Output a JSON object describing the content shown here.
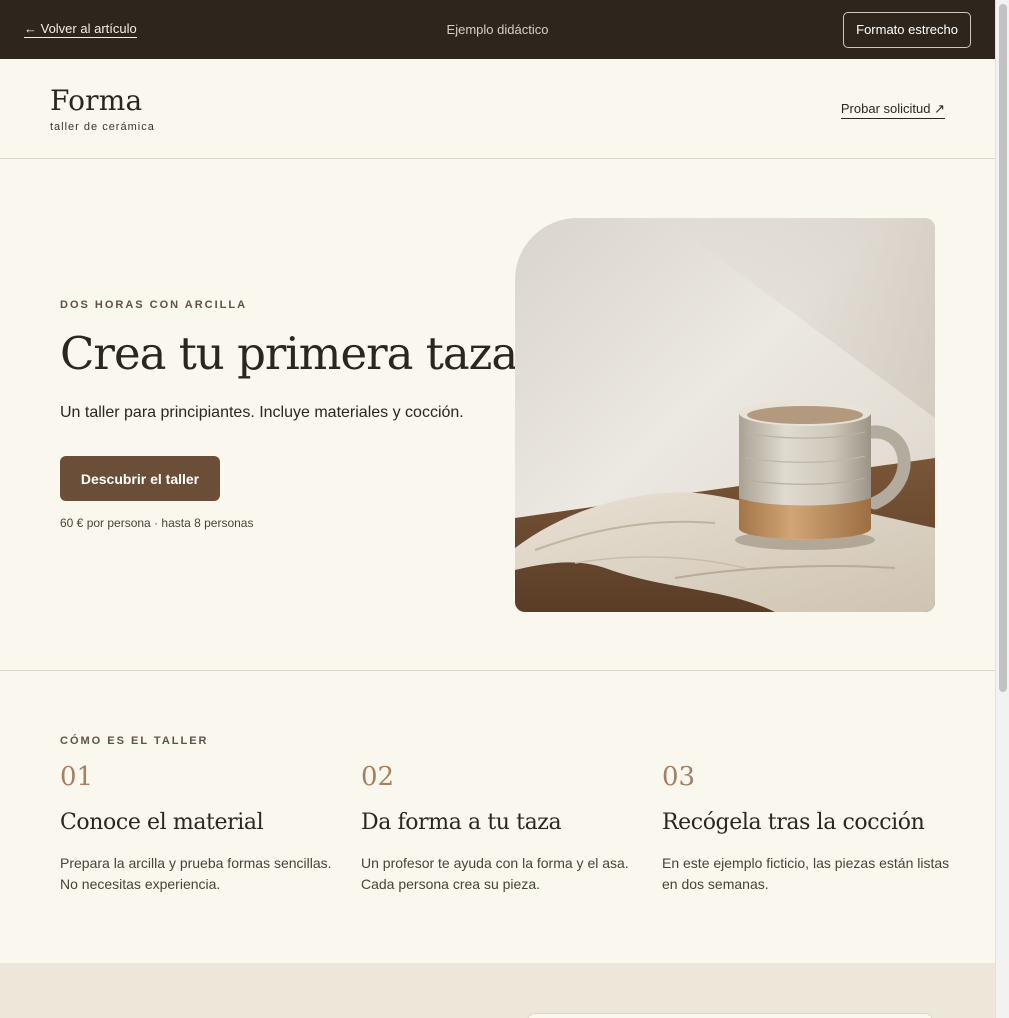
{
  "topbar": {
    "back_label": "← Volver al artículo",
    "center_title": "Ejemplo didáctico",
    "format_button": "Formato estrecho"
  },
  "header": {
    "brand": "Forma",
    "tagline": "taller de cerámica",
    "try_link": "Probar solicitud ↗"
  },
  "hero": {
    "eyebrow": "DOS HORAS CON ARCILLA",
    "title": "Crea tu primera taza",
    "subtitle": "Un taller para principiantes. Incluye materiales y cocción.",
    "cta": "Descubrir el taller",
    "price_note": "60 € por persona · hasta 8 personas",
    "image_icon": "ceramic-mug-photo"
  },
  "steps": {
    "eyebrow": "CÓMO ES EL TALLER",
    "items": [
      {
        "number": "01",
        "title": "Conoce el material",
        "text": "Prepara la arcilla y prueba formas sencillas. No necesitas experiencia."
      },
      {
        "number": "02",
        "title": "Da forma a tu taza",
        "text": "Un profesor te ayuda con la forma y el asa. Cada persona crea su pieza."
      },
      {
        "number": "03",
        "title": "Recógela tras la cocción",
        "text": "En este ejemplo ficticio, las piezas están listas en dos semanas."
      }
    ]
  },
  "colors": {
    "topbar": "#2e261d",
    "background": "#faf7ef",
    "accent_button": "#6a4e37",
    "step_number": "#a48062"
  }
}
